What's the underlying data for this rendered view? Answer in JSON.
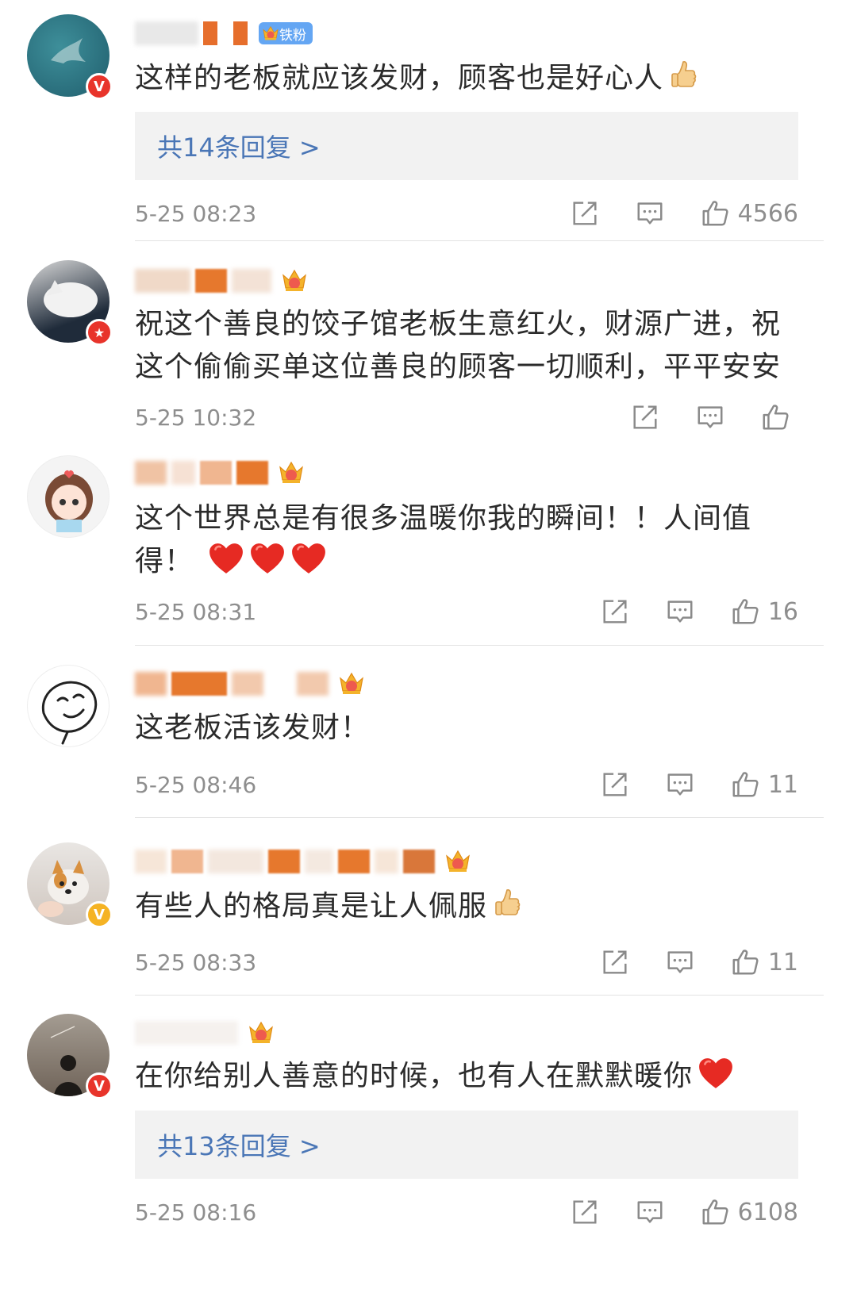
{
  "comments": [
    {
      "badge_label": "铁粉",
      "text": "这样的老板就应该发财，顾客也是好心人",
      "reply_label": "共14条回复 >",
      "time": "5-25 08:23",
      "likes": "4566",
      "avatar_icon": "whale-tail-icon",
      "verify_color": "#e8342b",
      "verify_letter": "V"
    },
    {
      "text": "祝这个善良的饺子馆老板生意红火，财源广进，祝这个偷偷买单这位善良的顾客一切顺利，平平安安",
      "time": "5-25 10:32",
      "likes": "",
      "avatar_icon": "white-cat-icon",
      "verify_color": "#e8342b",
      "verify_letter": "★"
    },
    {
      "text": "这个世界总是有很多温暖你我的瞬间！！人间值得！",
      "time": "5-25 08:31",
      "likes": "16",
      "avatar_icon": "cartoon-girl-icon"
    },
    {
      "text": "这老板活该发财！",
      "time": "5-25 08:46",
      "likes": "11",
      "avatar_icon": "sketch-face-icon"
    },
    {
      "text": "有些人的格局真是让人佩服",
      "time": "5-25 08:33",
      "likes": "11",
      "avatar_icon": "corgi-dog-icon",
      "verify_color": "#f5b324",
      "verify_letter": "V"
    },
    {
      "text": "在你给别人善意的时候，也有人在默默暖你",
      "reply_label": "共13条回复 >",
      "time": "5-25 08:16",
      "likes": "6108",
      "avatar_icon": "silhouette-person-icon",
      "verify_color": "#e8342b",
      "verify_letter": "V"
    }
  ],
  "colors": {
    "link": "#4a76b6",
    "meta": "#8e8e8e",
    "reply_bg": "#f2f2f2"
  }
}
